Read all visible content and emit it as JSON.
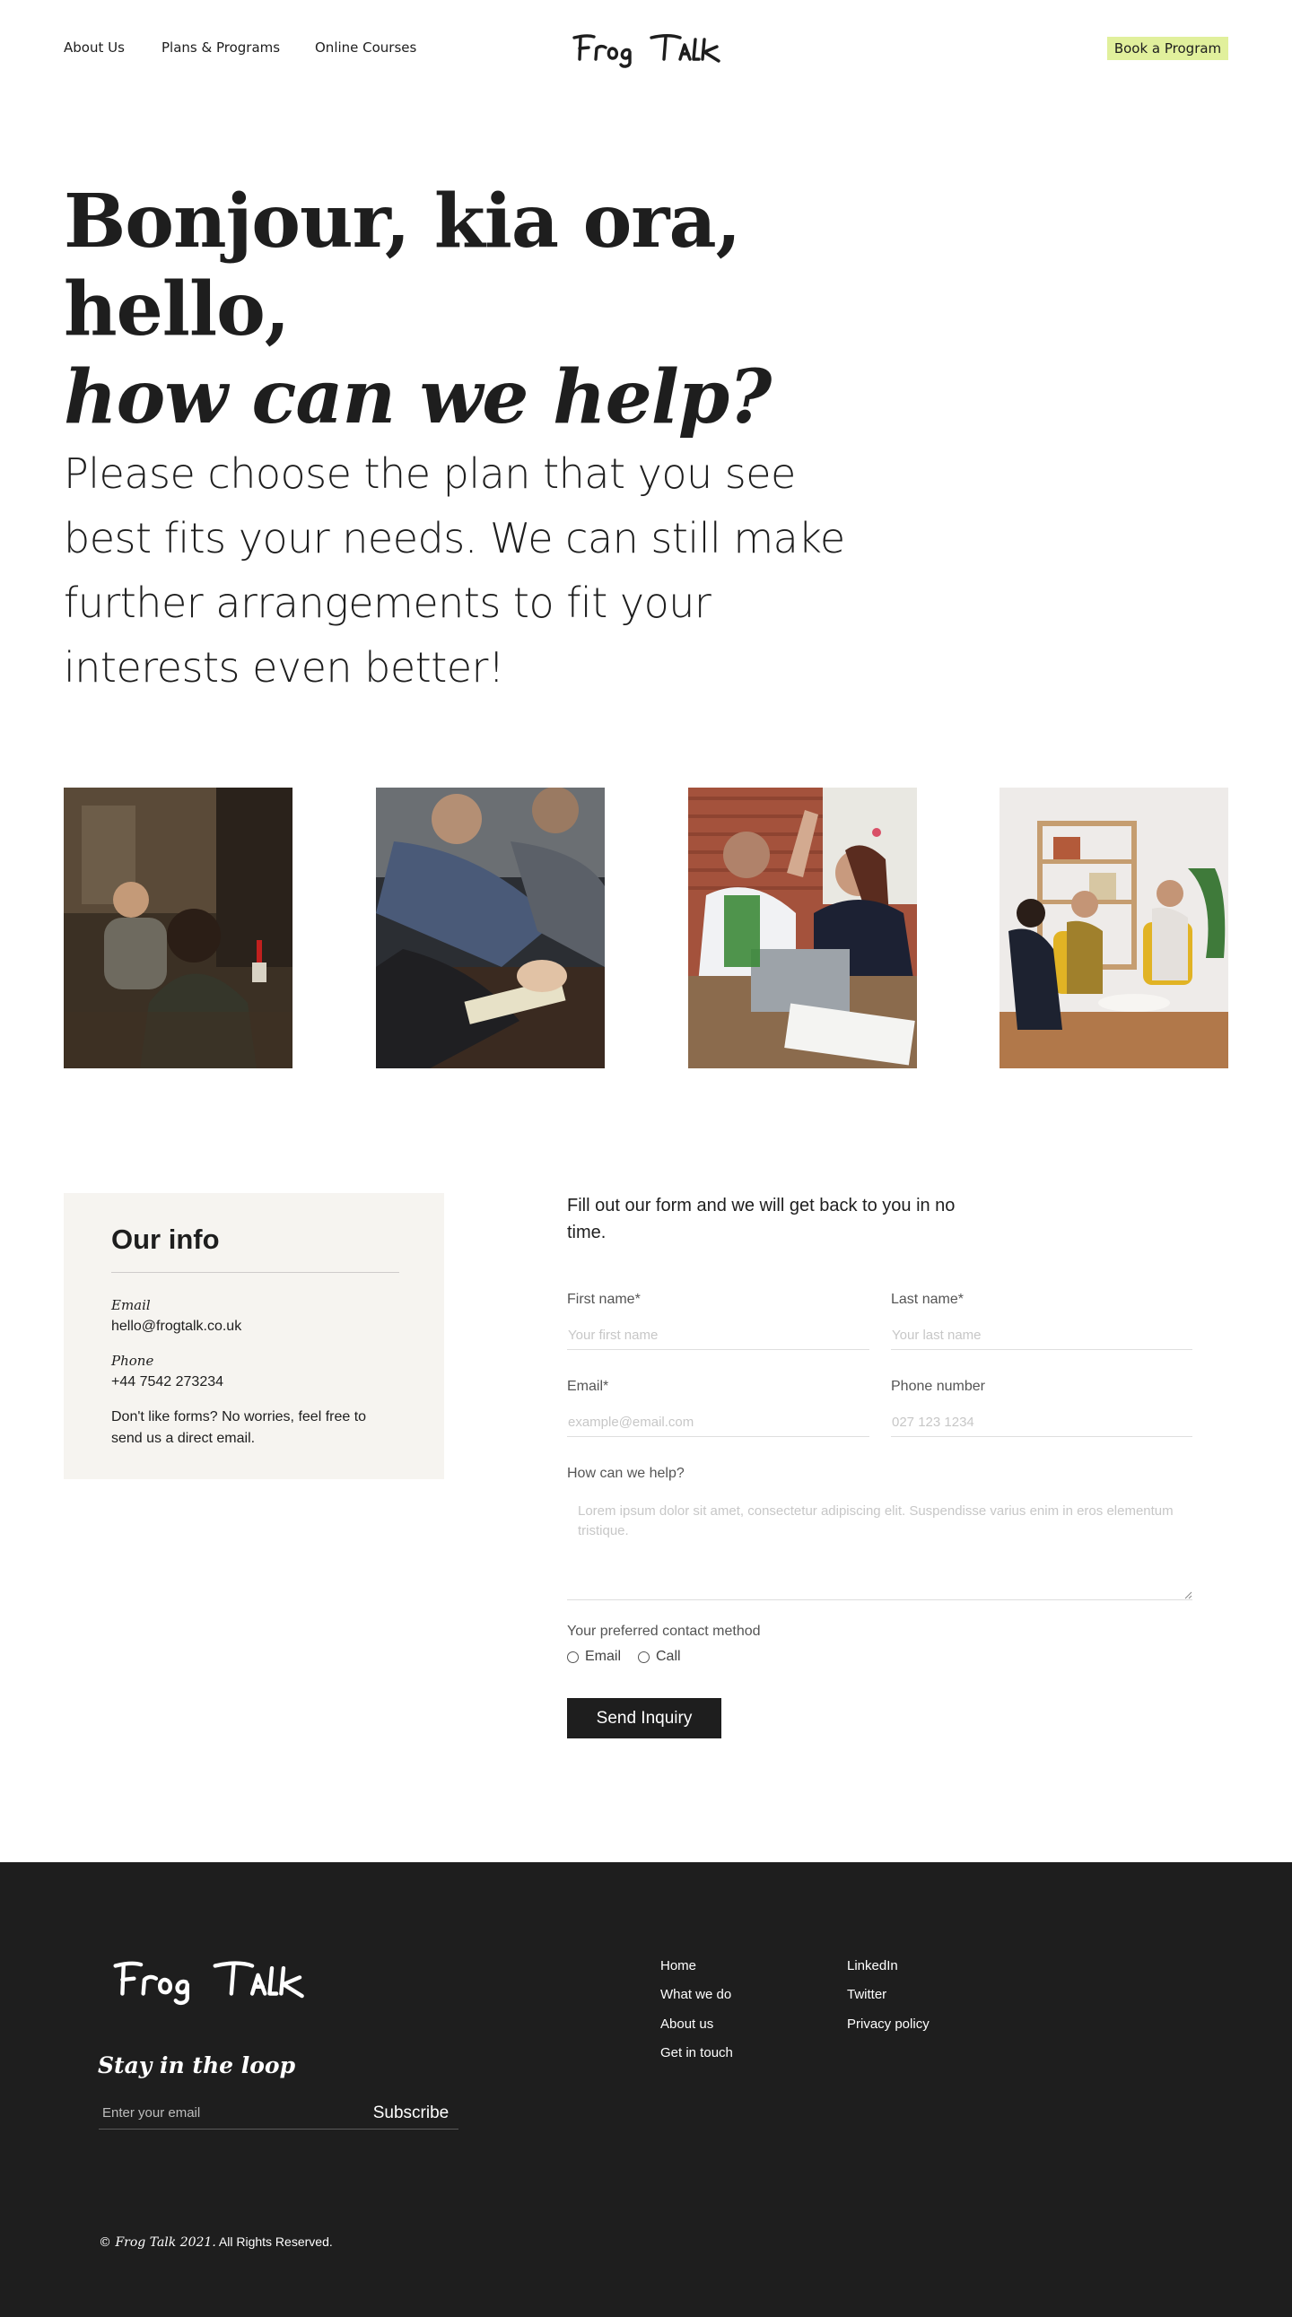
{
  "nav": {
    "about": "About Us",
    "plans": "Plans & Programs",
    "courses": "Online Courses",
    "book": "Book a Program"
  },
  "brand": {
    "logo_text": "Frog Talk"
  },
  "hero": {
    "line1": "Bonjour, kia ora, hello,",
    "line2": "how can we help?",
    "paragraph": "Please choose the plan that you see best fits your needs. We can still make further arrangements to fit your interests even better!"
  },
  "info": {
    "title": "Our info",
    "email_label": "Email",
    "email_value": "hello@frogtalk.co.uk",
    "phone_label": "Phone",
    "phone_value": "+44 7542 273234",
    "note": "Don't like forms? No worries, feel free to send us a direct email."
  },
  "form": {
    "intro": "Fill out our form and we will get back to you in no time.",
    "first_name_label": "First name*",
    "first_name_placeholder": "Your first name",
    "last_name_label": "Last name*",
    "last_name_placeholder": "Your last name",
    "email_label": "Email*",
    "email_placeholder": "example@email.com",
    "phone_label": "Phone number",
    "phone_placeholder": "027 123 1234",
    "help_label": "How can we help?",
    "help_placeholder": "Lorem ipsum dolor sit amet, consectetur adipiscing elit. Suspendisse varius enim in eros elementum tristique.",
    "contact_label": "Your preferred contact method",
    "option_email": "Email",
    "option_call": "Call",
    "submit": "Send Inquiry"
  },
  "footer": {
    "stay_title": "Stay in the loop",
    "subscribe_placeholder": "Enter your email",
    "subscribe_button": "Subscribe",
    "links_col1": [
      "Home",
      "What we do",
      "About us",
      "Get in touch"
    ],
    "links_col2": [
      "LinkedIn",
      "Twitter",
      "Privacy policy"
    ],
    "copyright_italic": "© Frog Talk 2021.",
    "copyright_rest": " All Rights Reserved."
  },
  "colors": {
    "accent": "#e1f09c",
    "dark": "#1e1e1e",
    "card_bg": "#f6f4f0"
  }
}
